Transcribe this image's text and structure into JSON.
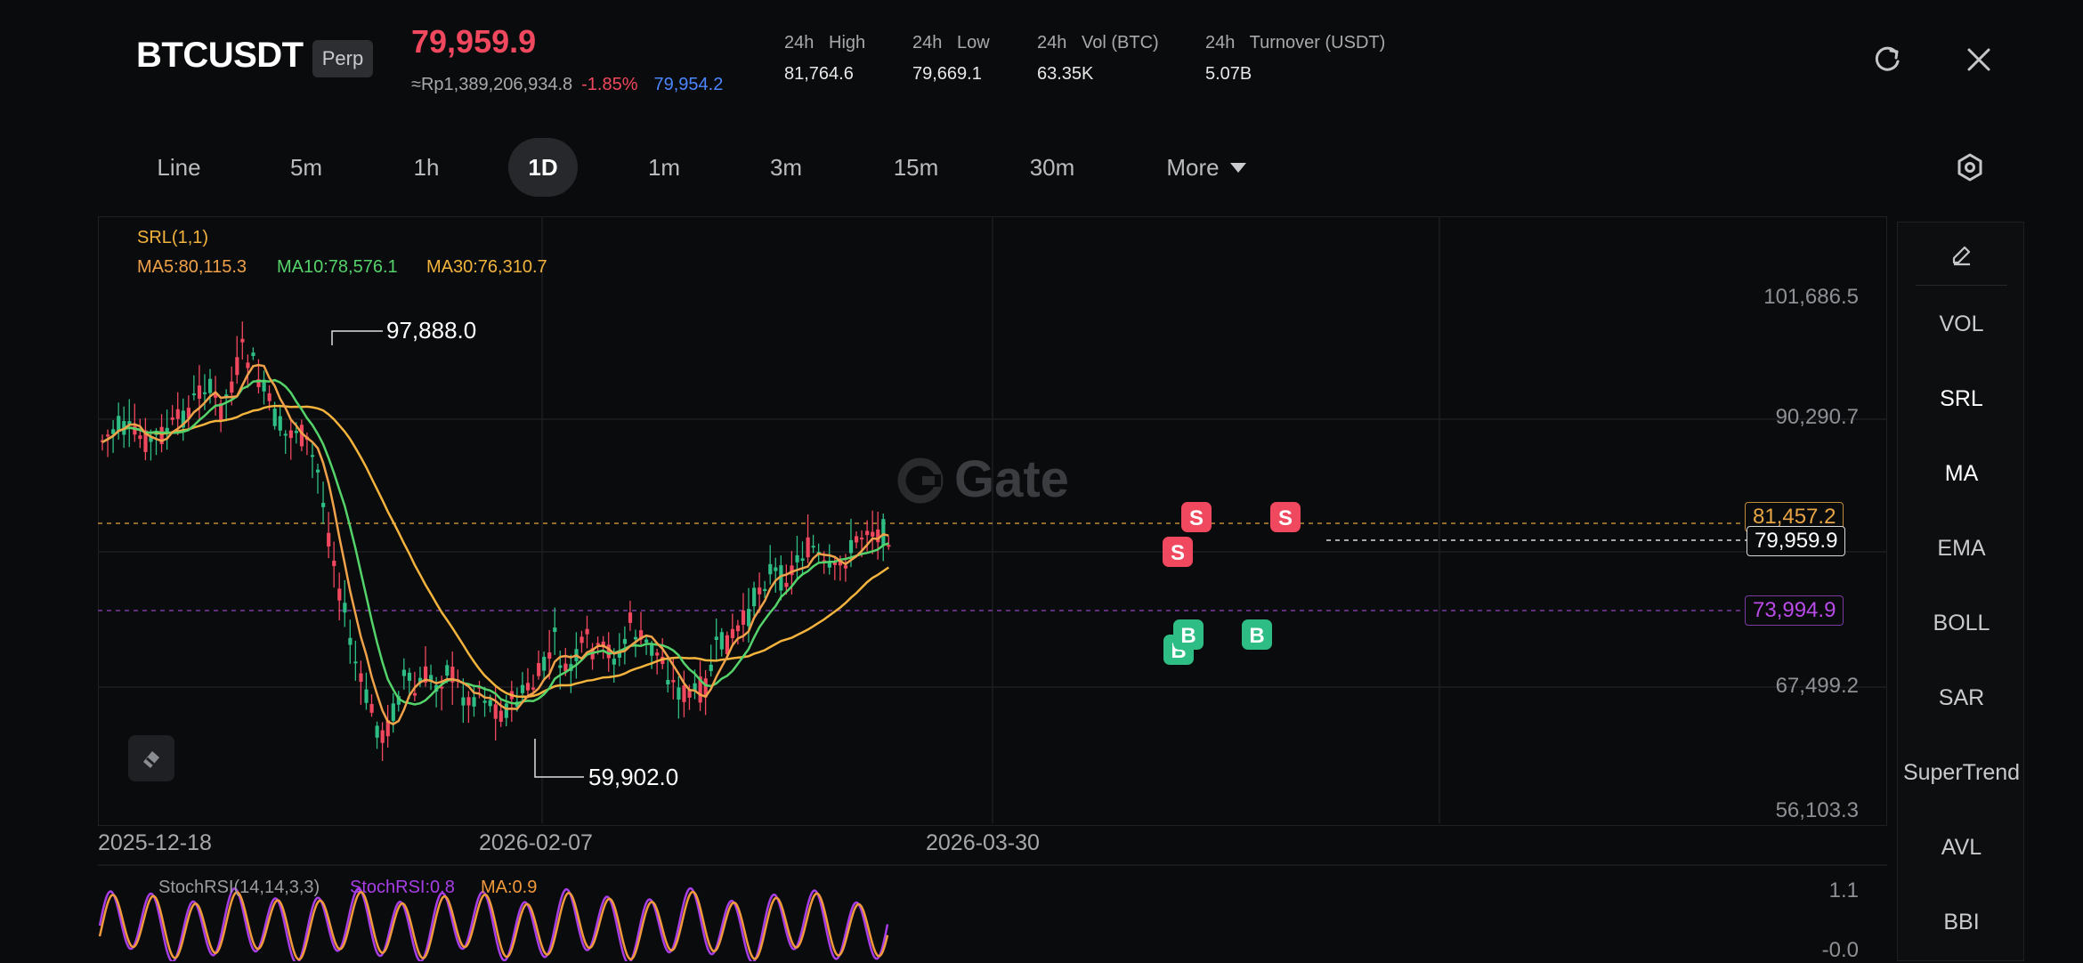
{
  "header": {
    "symbol": "BTCUSDT",
    "badge": "Perp",
    "last_price": "79,959.9",
    "local_price": "≈Rp1,389,206,934.8",
    "change_pct": "-1.85%",
    "index_price": "79,954.2",
    "stats": [
      {
        "label": "24h   High",
        "value": "81,764.6"
      },
      {
        "label": "24h   Low",
        "value": "79,669.1"
      },
      {
        "label": "24h   Vol (BTC)",
        "value": "63.35K"
      },
      {
        "label": "24h   Turnover (USDT)",
        "value": "5.07B"
      }
    ],
    "icons": {
      "refresh": "refresh-icon",
      "close": "close-icon"
    }
  },
  "timeframes": {
    "tabs": [
      "Line",
      "5m",
      "1h",
      "1D",
      "1m",
      "3m",
      "15m",
      "30m"
    ],
    "active": "1D",
    "more_label": "More",
    "settings_icon": "settings-hexagon-icon"
  },
  "chart": {
    "srl_label": "SRL(1,1)",
    "ma5": "MA5:80,115.3",
    "ma10": "MA10:78,576.1",
    "ma30": "MA30:76,310.7",
    "high_marker": "97,888.0",
    "low_marker": "59,902.0",
    "y_ticks": [
      "101,686.5",
      "90,290.7",
      "67,499.2",
      "56,103.3"
    ],
    "x_ticks": [
      "2025-12-18",
      "2026-02-07",
      "2026-03-30"
    ],
    "tag_resistance": "81,457.2",
    "tag_current": "79,959.9",
    "tag_support": "73,994.9",
    "watermark": "Gate",
    "signals": [
      "S",
      "S",
      "S",
      "B",
      "B",
      "B"
    ],
    "colors": {
      "up": "#2ebd85",
      "down": "#f0485e",
      "ma5": "#f0a24a",
      "ma10": "#55d36b",
      "ma30": "#f3b33d",
      "support": "#a53bd6"
    }
  },
  "oscillator": {
    "label": "StochRSI(14,14,3,3)",
    "stochrsi": "StochRSI:0.8",
    "ma": "MA:0.9",
    "y_ticks": [
      "1.1",
      "-0.0"
    ]
  },
  "side_panel": {
    "edit_icon": "pencil-icon",
    "items": [
      "VOL",
      "SRL",
      "MA",
      "EMA",
      "BOLL",
      "SAR",
      "SuperTrend",
      "AVL",
      "BBI"
    ],
    "active": [
      "SRL",
      "MA"
    ]
  }
}
